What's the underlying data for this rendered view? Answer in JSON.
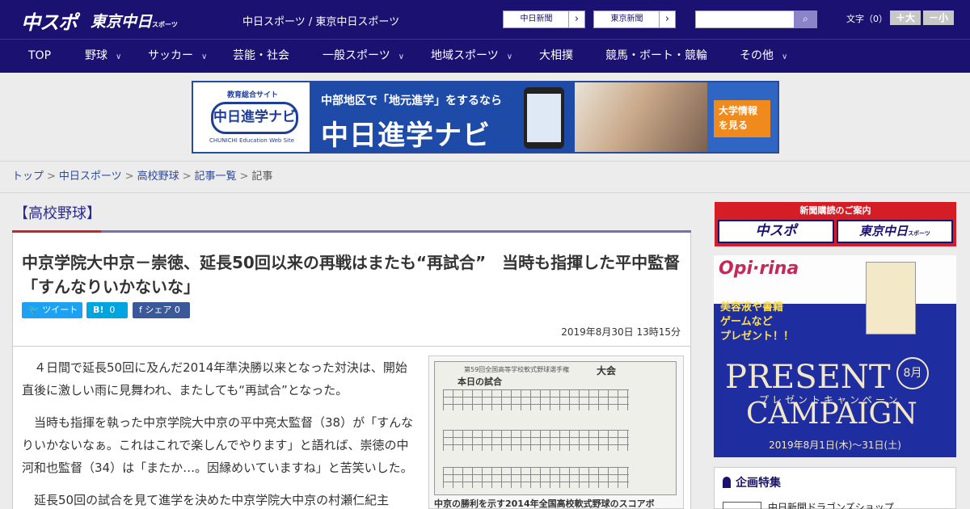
{
  "header": {
    "logo_chunichi_sports": "中スポ",
    "logo_tokyo_main": "東京中日",
    "logo_tokyo_suffix": "スポーツ",
    "site_links": "中日スポーツ / 東京中日スポーツ",
    "btn_chunichi": "中日新聞",
    "btn_tokyo": "東京新聞",
    "search_placeholder": "",
    "font_label": "文字（0）",
    "font_up": "＋大",
    "font_down": "－小"
  },
  "nav": {
    "items": [
      {
        "label": "TOP",
        "has_menu": false
      },
      {
        "label": "野球",
        "has_menu": true
      },
      {
        "label": "サッカー",
        "has_menu": true
      },
      {
        "label": "芸能・社会",
        "has_menu": false
      },
      {
        "label": "一般スポーツ",
        "has_menu": true
      },
      {
        "label": "地域スポーツ",
        "has_menu": true
      },
      {
        "label": "大相撲",
        "has_menu": false
      },
      {
        "label": "競馬・ボート・競輪",
        "has_menu": false
      },
      {
        "label": "その他",
        "has_menu": true
      }
    ]
  },
  "banner": {
    "kyoiku": "教育総合サイト",
    "logo": "中日進学ナビ",
    "logo_en": "CHUNICHI Education Web Site",
    "sub": "中部地区で「地元進学」をするなら",
    "title": "中日進学ナビ",
    "cta_line1": "大学情報",
    "cta_line2": "を見る"
  },
  "breadcrumb": {
    "items": [
      "トップ",
      "中日スポーツ",
      "高校野球",
      "記事一覧"
    ],
    "current": "記事",
    "separator": ">"
  },
  "category": "【高校野球】",
  "article": {
    "headline": "中京学院大中京－崇徳、延長50回以来の再戦はまたも“再試合”　当時も指揮した平中監督「すんなりいかないな」",
    "share_tweet": "ツイート",
    "share_hatena": "B!",
    "share_hatena_count": "0",
    "share_fb": "シェア",
    "share_fb_count": "0",
    "date": "2019年8月30日 13時15分",
    "paragraphs": [
      "４日間で延長50回に及んだ2014年準決勝以来となった対決は、開始直後に激しい雨に見舞われ、またしても“再試合”となった。",
      "当時も指揮を執った中京学院大中京の平中亮太監督（38）が「すんなりいかないなぁ。これはこれで楽しんでやります」と語れば、崇徳の中河和也監督（34）は「またか…。因縁めいていますね」と苦笑いした。",
      "延長50回の試合を見て進学を決めた中京学院大中京の村瀬仁紀主"
    ],
    "figure_header": "第59回全国高等学校軟式野球選手権",
    "figure_title": "本日の試合",
    "figure_taikai": "大会",
    "figure_caption": "中京の勝利を示す2014年全国高校軟式野球のスコアボ"
  },
  "sidebar": {
    "subscribe_label": "新聞購読のご案内",
    "subscribe_left": "中スポ",
    "subscribe_right": "東京中日",
    "subscribe_right_suffix": "スポーツ",
    "ad_brand": "Opi·rina",
    "ad_copy1": "美容液や書籍",
    "ad_copy2": "ゲームなど",
    "ad_copy3": "プレゼント！！",
    "ad_present": "PRESENT",
    "ad_month": "8月",
    "ad_kana": "プレゼントキャンペーン",
    "ad_campaign": "CAMPAIGN",
    "ad_date": "2019年8月1日(木)～31日(土)",
    "feature_title": "企画特集",
    "feature_item": "中日新聞ドラゴンズショップ"
  },
  "colors": {
    "header_bg": "#1a1170",
    "accent_red": "#d0202a",
    "twitter": "#1da1f2",
    "hatena": "#00a4de",
    "facebook": "#3b5998"
  }
}
